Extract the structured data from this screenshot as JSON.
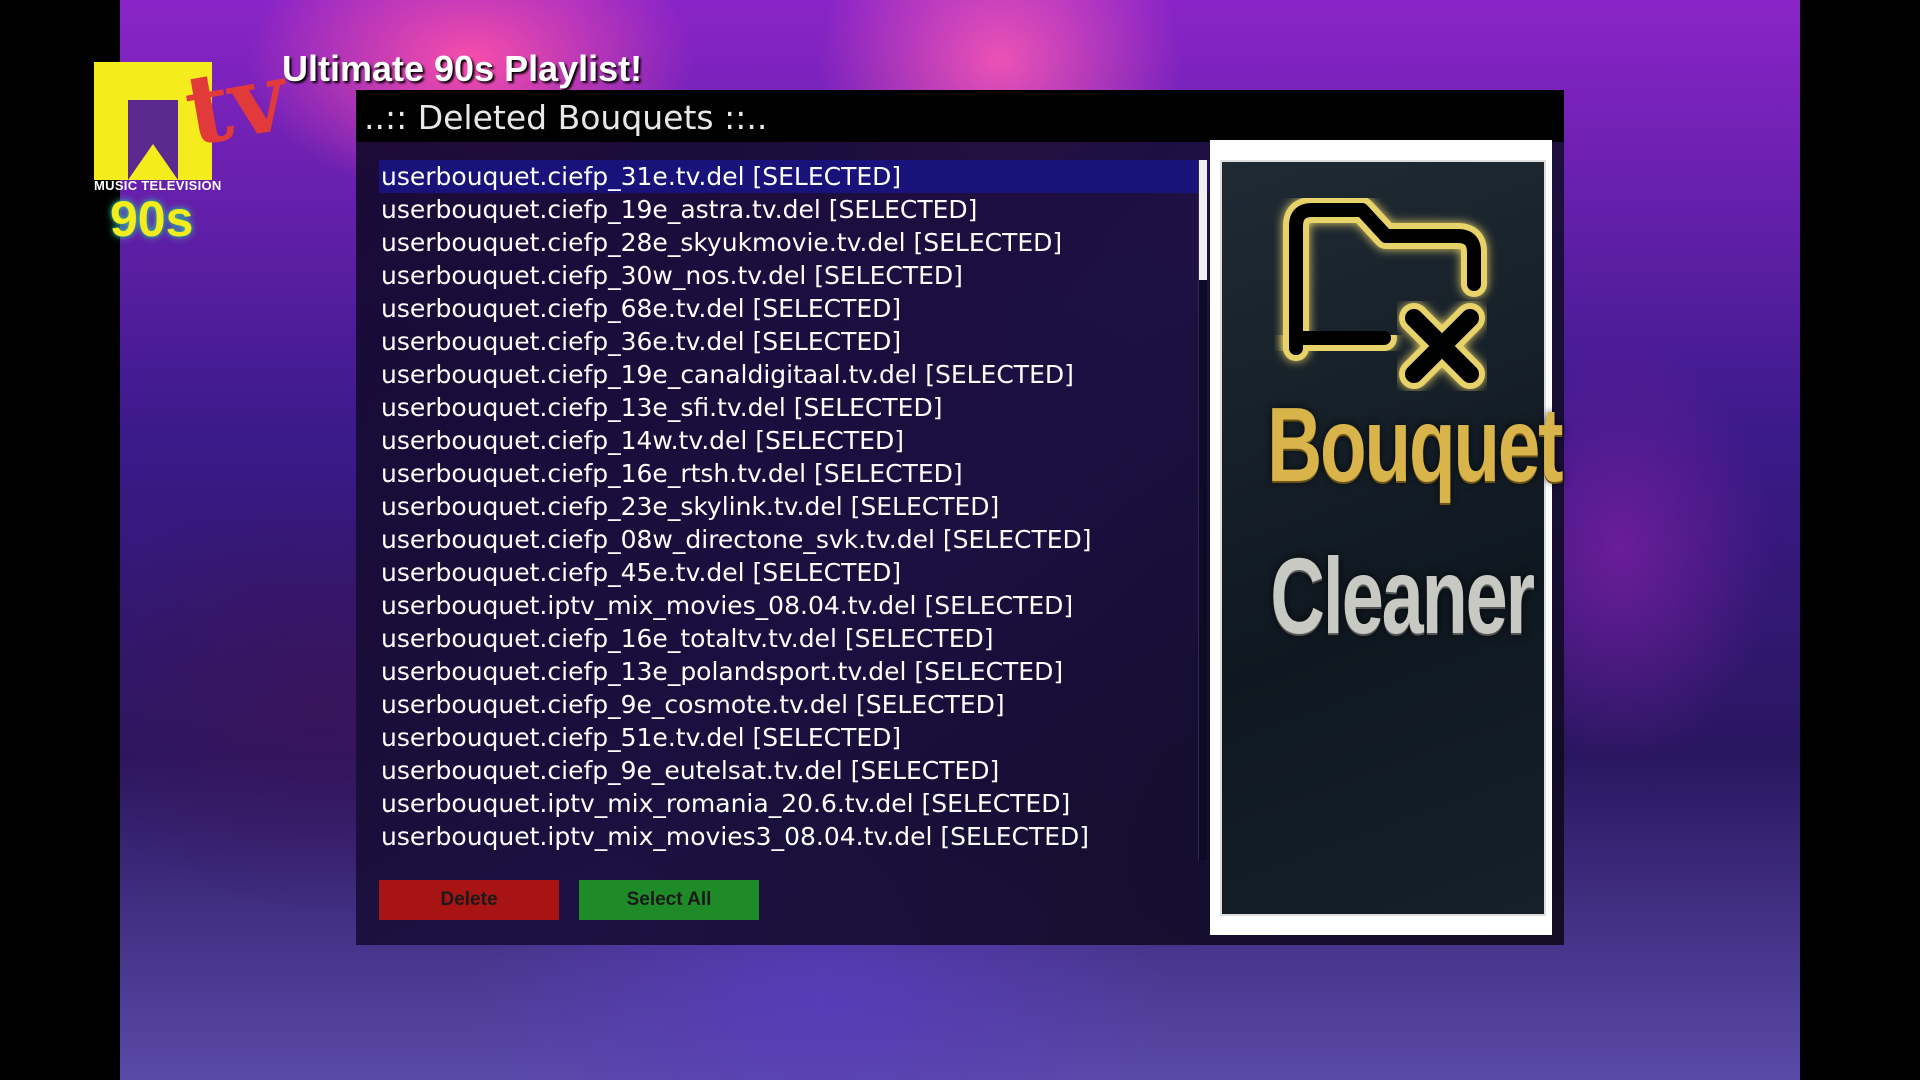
{
  "video": {
    "caption": "Ultimate 90s Playlist!",
    "logo": {
      "brand": "MTV",
      "caption": "MUSIC TELEVISION",
      "tagline": "90s"
    }
  },
  "dialog": {
    "title": "..:: Deleted Bouquets ::..",
    "selected_index": 0,
    "items": [
      "userbouquet.ciefp_31e.tv.del [SELECTED]",
      "userbouquet.ciefp_19e_astra.tv.del [SELECTED]",
      "userbouquet.ciefp_28e_skyukmovie.tv.del [SELECTED]",
      "userbouquet.ciefp_30w_nos.tv.del [SELECTED]",
      "userbouquet.ciefp_68e.tv.del [SELECTED]",
      "userbouquet.ciefp_36e.tv.del [SELECTED]",
      "userbouquet.ciefp_19e_canaldigitaal.tv.del [SELECTED]",
      "userbouquet.ciefp_13e_sfi.tv.del [SELECTED]",
      "userbouquet.ciefp_14w.tv.del [SELECTED]",
      "userbouquet.ciefp_16e_rtsh.tv.del [SELECTED]",
      "userbouquet.ciefp_23e_skylink.tv.del [SELECTED]",
      "userbouquet.ciefp_08w_directone_svk.tv.del [SELECTED]",
      "userbouquet.ciefp_45e.tv.del [SELECTED]",
      "userbouquet.iptv_mix_movies_08.04.tv.del [SELECTED]",
      "userbouquet.ciefp_16e_totaltv.tv.del [SELECTED]",
      "userbouquet.ciefp_13e_polandsport.tv.del [SELECTED]",
      "userbouquet.ciefp_9e_cosmote.tv.del [SELECTED]",
      "userbouquet.ciefp_51e.tv.del [SELECTED]",
      "userbouquet.ciefp_9e_eutelsat.tv.del [SELECTED]",
      "userbouquet.iptv_mix_romania_20.6.tv.del [SELECTED]",
      "userbouquet.iptv_mix_movies3_08.04.tv.del [SELECTED]"
    ],
    "buttons": {
      "delete": "Delete",
      "select_all": "Select All"
    },
    "colors": {
      "delete": "#a81414",
      "select_all": "#1f8a28",
      "highlight": "#17137a"
    },
    "plugin_image": {
      "line1": "Bouquet",
      "line2": "Cleaner",
      "icon": "folder-x-icon"
    }
  }
}
